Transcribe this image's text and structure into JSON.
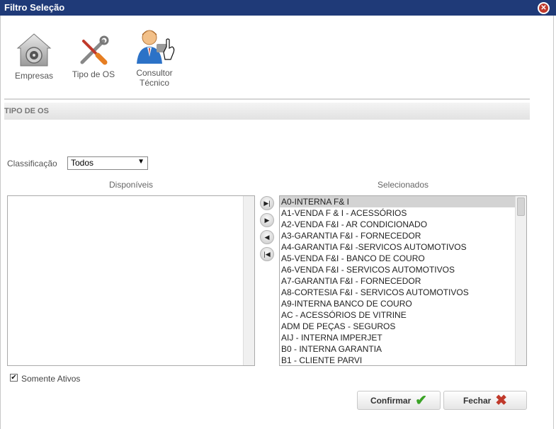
{
  "window": {
    "title": "Filtro Seleção"
  },
  "toolbar": {
    "empresas": "Empresas",
    "tipo_os": "Tipo de OS",
    "consultor_line1": "Consultor",
    "consultor_line2": "Técnico"
  },
  "section": {
    "header": "TIPO DE OS"
  },
  "filter": {
    "label": "Classificação",
    "selected": "Todos"
  },
  "lists": {
    "disponiveis_title": "Disponíveis",
    "selecionados_title": "Selecionados",
    "disponiveis": [],
    "selecionados": [
      "A0-INTERNA F& I",
      "A1-VENDA F & I - ACESSÓRIOS",
      "A2-VENDA F&I - AR CONDICIONADO",
      "A3-GARANTIA F&I - FORNECEDOR",
      "A4-GARANTIA F&I -SERVICOS AUTOMOTIVOS",
      "A5-VENDA F&I - BANCO DE COURO",
      "A6-VENDA F&I - SERVICOS AUTOMOTIVOS",
      "A7-GARANTIA F&I - FORNECEDOR",
      "A8-CORTESIA F&I - SERVICOS AUTOMOTIVOS",
      "A9-INTERNA BANCO DE COURO",
      "AC - ACESSÓRIOS DE VITRINE",
      "ADM DE PEÇAS - SEGUROS",
      "AIJ - INTERNA IMPERJET",
      "B0 - INTERNA GARANTIA",
      "B1 - CLIENTE PARVI"
    ],
    "selected_item": "A0-INTERNA F& I"
  },
  "options": {
    "somente_ativos": "Somente Ativos",
    "somente_ativos_checked": true
  },
  "buttons": {
    "confirmar": "Confirmar",
    "fechar": "Fechar"
  },
  "icons": {
    "empresas": "vault-icon",
    "tipo_os": "tools-icon",
    "consultor": "consultant-icon",
    "move_all_right": "move-all-right-icon",
    "move_right": "move-right-icon",
    "move_left": "move-left-icon",
    "move_all_left": "move-all-left-icon"
  },
  "colors": {
    "titlebar": "#1f3a78",
    "confirm_icon": "#3aa326",
    "close_icon": "#c0392b"
  }
}
